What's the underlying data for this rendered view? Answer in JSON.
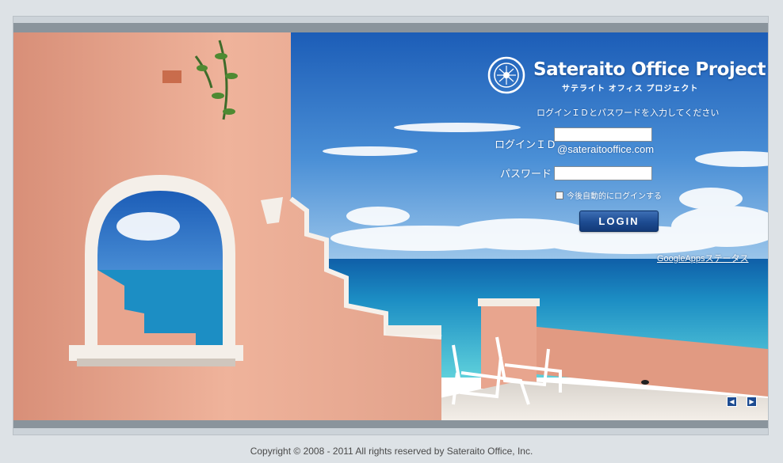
{
  "brand": {
    "title": "Sateraito Office Project",
    "subtitle": "サテライト オフィス プロジェクト",
    "emblem_text": "Sateraito Office Project"
  },
  "login_form": {
    "instruction": "ログインＩＤとパスワードを入力してください",
    "id_label": "ログインＩＤ",
    "id_value": "",
    "domain_suffix": "@sateraitooffice.com",
    "password_label": "パスワード",
    "password_value": "",
    "remember_label": "今後自動的にログインする",
    "remember_checked": false,
    "login_button": "LOGIN"
  },
  "links": {
    "status": "GoogleAppsステータス"
  },
  "slideshow": {
    "prev_icon": "triangle-left-icon",
    "next_icon": "triangle-right-icon",
    "prev_glyph": "◀",
    "next_glyph": "▶"
  },
  "footer": {
    "copyright": "Copyright © 2008 - 2011 All rights reserved by Sateraito Office, Inc."
  },
  "colors": {
    "page_background": "#dde2e6",
    "button": "#1d4b91",
    "sky": "#3a78c9",
    "sea": "#1fa1c4",
    "wall": "#e8a58e"
  }
}
